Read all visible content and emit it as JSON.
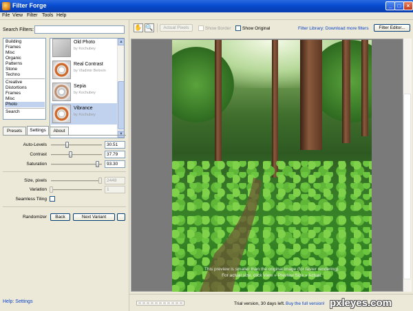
{
  "window": {
    "title": "Filter Forge"
  },
  "menu": [
    "File",
    "View",
    "Filter",
    "Tools",
    "Help"
  ],
  "search": {
    "label": "Search Filters:",
    "value": ""
  },
  "categories": {
    "group1": [
      "Building",
      "Frames",
      "Misc",
      "Organic",
      "Patterns",
      "Stone",
      "Techno"
    ],
    "group2": [
      "Creative",
      "Distortions",
      "Frames",
      "Misc",
      "Photo"
    ],
    "group3": [
      "Search"
    ],
    "selected": "Photo"
  },
  "filters": [
    {
      "name": "Old Photo",
      "author": "by Kochubey"
    },
    {
      "name": "Real Contrast",
      "author": "by Vladimir Belovin"
    },
    {
      "name": "Sepia",
      "author": "by Kochubey"
    },
    {
      "name": "Vibrance",
      "author": "by Kochubey"
    }
  ],
  "tabs": [
    "Presets",
    "Settings",
    "About"
  ],
  "active_tab": "Settings",
  "settings": {
    "auto_levels": {
      "label": "Auto-Levels",
      "value": "30.51",
      "level": 0.31
    },
    "contrast": {
      "label": "Contrast",
      "value": "37.79",
      "level": 0.38
    },
    "saturation": {
      "label": "Saturation",
      "value": "93.30",
      "level": 0.93
    },
    "size": {
      "label": "Size, pixels",
      "value": "2448",
      "level": 1.0
    },
    "variation": {
      "label": "Variation",
      "value": "1",
      "level": 0.0
    },
    "seamless": {
      "label": "Seamless Tiling"
    }
  },
  "randomizer": {
    "label": "Randomizer",
    "back": "Back",
    "next": "Next Variant"
  },
  "help_link": "Help: Settings",
  "toolbar": {
    "actual_pixels": "Actual Pixels",
    "show_border": "Show Border",
    "show_original": "Show Original",
    "library_link": "Filter Library: Download more filters",
    "editor_button": "Filter Editor...",
    "hand_icon": "hand-icon",
    "zoom_icon": "zoom-icon"
  },
  "preview": {
    "note1": "This preview is smaller than the original image (for faster rendering).",
    "note2": "For actual size, click View » Preview Size » Actual."
  },
  "status": {
    "trial": "Trial version, 30 days left.",
    "buy": "Buy the full version!"
  },
  "watermark": "pxleyes.com"
}
